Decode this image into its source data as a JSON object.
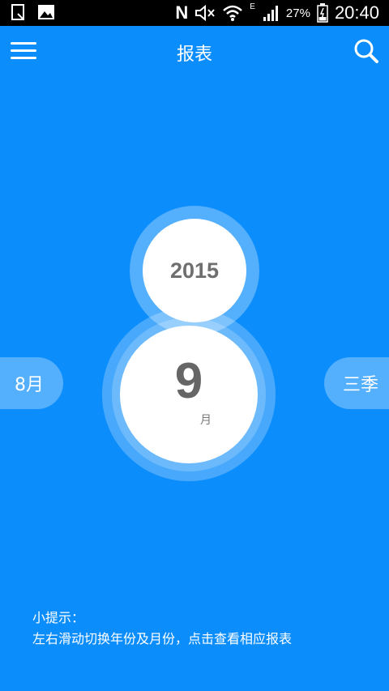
{
  "status_bar": {
    "time": "20:40",
    "battery_percent": "27%",
    "network_type": "E",
    "nfc_label": "N",
    "icons": [
      "screenshot-icon",
      "image-icon",
      "nfc-icon",
      "mute-icon",
      "wifi-icon",
      "signal-icon",
      "battery-icon"
    ]
  },
  "header": {
    "title": "报表",
    "menu_icon": "hamburger-menu-icon",
    "search_icon": "search-icon"
  },
  "selector": {
    "year": "2015",
    "month_number": "9",
    "month_unit": "月",
    "prev_label": "8月",
    "next_label": "三季"
  },
  "tip": {
    "heading": "小提示：",
    "text": "左右滑动切换年份及月份，点击查看相应报表"
  },
  "colors": {
    "background": "#0b8dfb",
    "status_bar": "#000000",
    "number_text": "#666666"
  }
}
